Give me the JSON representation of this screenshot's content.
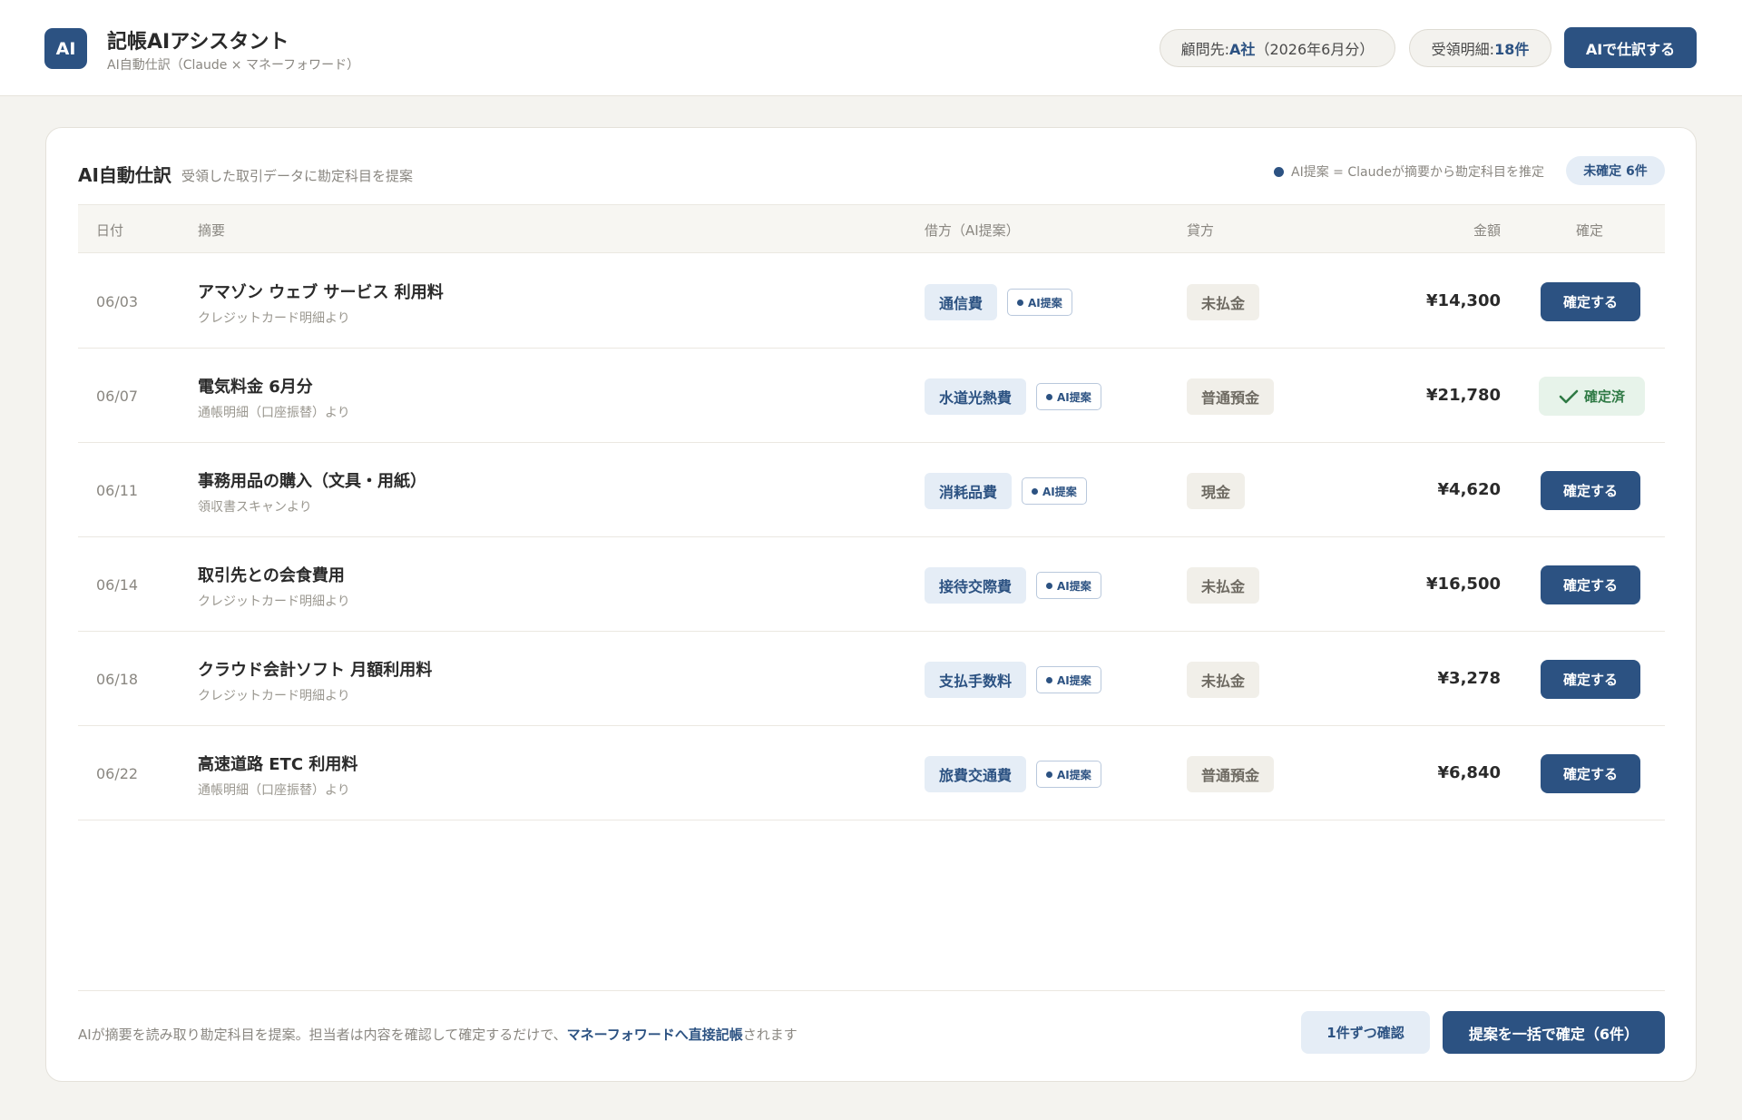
{
  "header": {
    "logo_text": "AI",
    "title": "記帳AIアシスタント",
    "subtitle": "AI自動仕訳（Claude × マネーフォワード）",
    "client_label": "顧問先: ",
    "client_value": "A社",
    "client_period": "（2026年6月分）",
    "received_label": "受領明細: ",
    "received_value": "18件",
    "action_button": "AIで仕訳する"
  },
  "card": {
    "title": "AI自動仕訳",
    "description": "受領した取引データに勘定科目を提案",
    "legend_text": "AI提案 = Claudeが摘要から勘定科目を推定",
    "pending_badge": "未確定 6件"
  },
  "table": {
    "headers": {
      "date": "日付",
      "description": "摘要",
      "debit": "借方（AI提案）",
      "credit": "貸方",
      "amount": "金額",
      "confirm": "確定"
    },
    "ai_chip_label": "AI提案",
    "confirm_label": "確定する",
    "confirmed_label": "確定済",
    "rows": [
      {
        "date": "06/03",
        "title": "アマゾン ウェブ サービス 利用料",
        "source": "クレジットカード明細より",
        "debit": "通信費",
        "credit": "未払金",
        "amount": "¥14,300",
        "confirmed": false
      },
      {
        "date": "06/07",
        "title": "電気料金 6月分",
        "source": "通帳明細（口座振替）より",
        "debit": "水道光熱費",
        "credit": "普通預金",
        "amount": "¥21,780",
        "confirmed": true
      },
      {
        "date": "06/11",
        "title": "事務用品の購入（文具・用紙）",
        "source": "領収書スキャンより",
        "debit": "消耗品費",
        "credit": "現金",
        "amount": "¥4,620",
        "confirmed": false
      },
      {
        "date": "06/14",
        "title": "取引先との会食費用",
        "source": "クレジットカード明細より",
        "debit": "接待交際費",
        "credit": "未払金",
        "amount": "¥16,500",
        "confirmed": false
      },
      {
        "date": "06/18",
        "title": "クラウド会計ソフト 月額利用料",
        "source": "クレジットカード明細より",
        "debit": "支払手数料",
        "credit": "未払金",
        "amount": "¥3,278",
        "confirmed": false
      },
      {
        "date": "06/22",
        "title": "高速道路 ETC 利用料",
        "source": "通帳明細（口座振替）より",
        "debit": "旅費交通費",
        "credit": "普通預金",
        "amount": "¥6,840",
        "confirmed": false
      }
    ]
  },
  "footer": {
    "text_before": "AIが摘要を読み取り勘定科目を提案。担当者は内容を確認して確定するだけで、",
    "text_link": "マネーフォワードへ直接記帳",
    "text_after": "されます",
    "secondary_button": "1件ずつ確認",
    "primary_button": "提案を一括で確定（6件）"
  },
  "colors": {
    "accent": "#2c5282",
    "background": "#f4f3ef",
    "confirmed_green": "#2f7a45"
  }
}
